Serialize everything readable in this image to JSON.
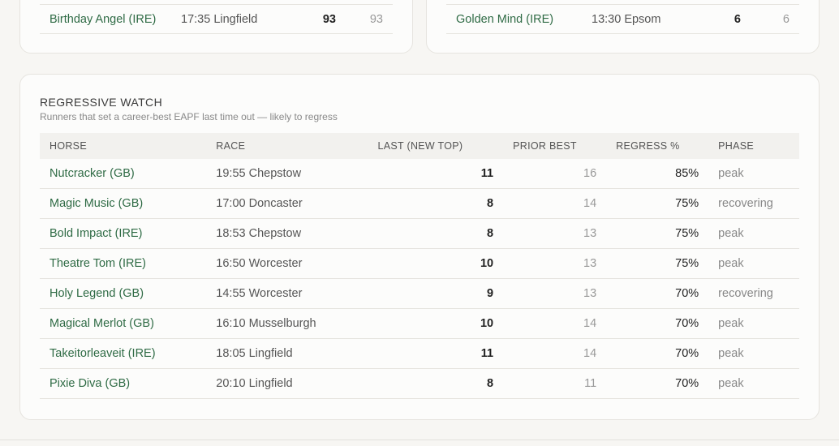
{
  "top_left_row": {
    "horse": "Birthday Angel (IRE)",
    "race": "17:35 Lingfield",
    "value": "93",
    "secondary": "93"
  },
  "top_right_row": {
    "horse": "Golden Mind (IRE)",
    "race": "13:30 Epsom",
    "value": "6",
    "secondary": "6"
  },
  "regressive": {
    "title": "REGRESSIVE WATCH",
    "subtitle": "Runners that set a career-best EAPF last time out — likely to regress",
    "columns": [
      "HORSE",
      "RACE",
      "LAST (NEW TOP)",
      "PRIOR BEST",
      "REGRESS %",
      "PHASE"
    ],
    "rows": [
      {
        "horse": "Nutcracker (GB)",
        "race": "19:55 Chepstow",
        "last": "11",
        "prior": "16",
        "regress": "85%",
        "phase": "peak"
      },
      {
        "horse": "Magic Music (GB)",
        "race": "17:00 Doncaster",
        "last": "8",
        "prior": "14",
        "regress": "75%",
        "phase": "recovering"
      },
      {
        "horse": "Bold Impact (IRE)",
        "race": "18:53 Chepstow",
        "last": "8",
        "prior": "13",
        "regress": "75%",
        "phase": "peak"
      },
      {
        "horse": "Theatre Tom (IRE)",
        "race": "16:50 Worcester",
        "last": "10",
        "prior": "13",
        "regress": "75%",
        "phase": "peak"
      },
      {
        "horse": "Holy Legend (GB)",
        "race": "14:55 Worcester",
        "last": "9",
        "prior": "13",
        "regress": "70%",
        "phase": "recovering"
      },
      {
        "horse": "Magical Merlot (GB)",
        "race": "16:10 Musselburgh",
        "last": "10",
        "prior": "14",
        "regress": "70%",
        "phase": "peak"
      },
      {
        "horse": "Takeitorleaveit (IRE)",
        "race": "18:05 Lingfield",
        "last": "11",
        "prior": "14",
        "regress": "70%",
        "phase": "peak"
      },
      {
        "horse": "Pixie Diva (GB)",
        "race": "20:10 Lingfield",
        "last": "8",
        "prior": "11",
        "regress": "70%",
        "phase": "peak"
      }
    ]
  },
  "colors": {
    "horse_link": "#2f6b45",
    "background": "#f7f6f3",
    "card": "#fcfcfb",
    "header_band": "#f2f1ee"
  }
}
